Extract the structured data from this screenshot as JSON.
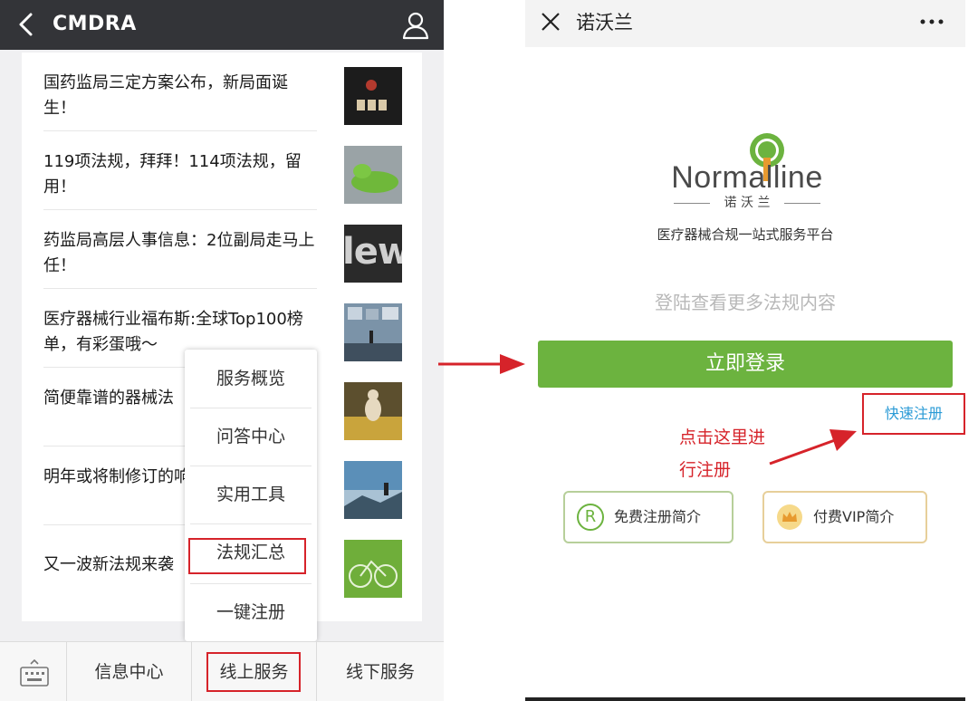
{
  "left_app": {
    "title": "CMDRA",
    "articles": [
      {
        "text": "国药监局三定方案公布，新局面诞生！"
      },
      {
        "text": "119项法规，拜拜！114项法规，留用！"
      },
      {
        "text": "药监局高层人事信息：2位副局走马上任！"
      },
      {
        "text": "医疗器械行业福布斯:全球Top100榜单，有彩蛋哦～"
      },
      {
        "text": "简便靠谱的器械法"
      },
      {
        "text": "明年或将制修订的响你的产品吗？"
      },
      {
        "text": "又一波新法规来袭"
      }
    ],
    "thumb_text": "lew",
    "popup_menu": [
      "服务概览",
      "问答中心",
      "实用工具",
      "法规汇总",
      "一键注册"
    ],
    "bottom_tabs": [
      "信息中心",
      "线上服务",
      "线下服务"
    ]
  },
  "right_app": {
    "title": "诺沃兰",
    "logo_text": "Normalline",
    "logo_cn": "诺 沃 兰",
    "tagline": "医疗器械合规一站式服务平台",
    "subtitle": "登陆查看更多法规内容",
    "login_button": "立即登录",
    "fast_register": "快速注册",
    "free_intro": "免费注册简介",
    "free_icon": "R",
    "vip_intro": "付费VIP简介"
  },
  "annotation": {
    "line1": "点击这里进",
    "line2": "行注册"
  },
  "colors": {
    "header_dark": "#333438",
    "accent_green": "#6cb33f",
    "annotation_red": "#d6232a",
    "link_blue": "#2b9bd6"
  }
}
